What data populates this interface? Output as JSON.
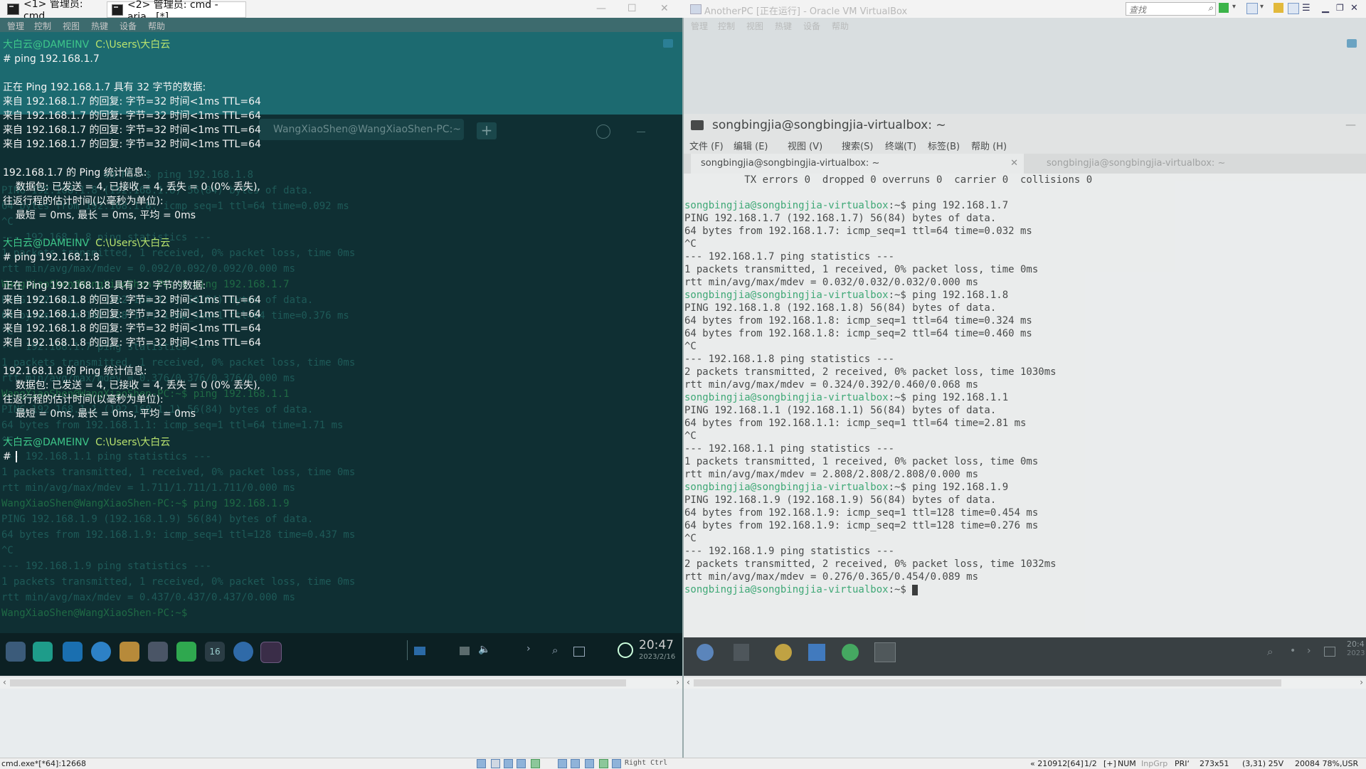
{
  "tabs": [
    {
      "label": "<1> 管理员: cmd"
    },
    {
      "label": "<2> 管理员: cmd - aria...[*]"
    }
  ],
  "vbox_title": "AnotherPC [正在运行] - Oracle VM VirtualBox",
  "search_placeholder": "查找",
  "vm_menu": [
    "管理",
    "控制",
    "视图",
    "热键",
    "设备",
    "帮助"
  ],
  "cmd": {
    "prompt_user": "大白云@DAMEINV",
    "prompt_path": "C:\\Users\\大白云",
    "lines_block1": [
      "# ping 192.168.1.7",
      "",
      "正在 Ping 192.168.1.7 具有 32 字节的数据:",
      "来自 192.168.1.7 的回复: 字节=32 时间<1ms TTL=64",
      "来自 192.168.1.7 的回复: 字节=32 时间<1ms TTL=64",
      "来自 192.168.1.7 的回复: 字节=32 时间<1ms TTL=64",
      "来自 192.168.1.7 的回复: 字节=32 时间<1ms TTL=64",
      "",
      "192.168.1.7 的 Ping 统计信息:",
      "    数据包: 已发送 = 4, 已接收 = 4, 丢失 = 0 (0% 丢失),",
      "往返行程的估计时间(以毫秒为单位):",
      "    最短 = 0ms, 最长 = 0ms, 平均 = 0ms"
    ],
    "lines_block2": [
      "# ping 192.168.1.8",
      "",
      "正在 Ping 192.168.1.8 具有 32 字节的数据:",
      "来自 192.168.1.8 的回复: 字节=32 时间<1ms TTL=64",
      "来自 192.168.1.8 的回复: 字节=32 时间<1ms TTL=64",
      "来自 192.168.1.8 的回复: 字节=32 时间<1ms TTL=64",
      "来自 192.168.1.8 的回复: 字节=32 时间<1ms TTL=64",
      "",
      "192.168.1.8 的 Ping 统计信息:",
      "    数据包: 已发送 = 4, 已接收 = 4, 丢失 = 0 (0% 丢失),",
      "往返行程的估计时间(以毫秒为单位):",
      "    最短 = 0ms, 最长 = 0ms, 平均 = 0ms"
    ],
    "last_prompt_hash": "#"
  },
  "deepin": {
    "tab_label": "WangXiaoShen@WangXiaoShen-PC:~",
    "bg_lines": [
      "                 en-PC:~$ ping 192.168.1.8",
      "PING 192.168.1.8 (192.168.1.8) 56(84) bytes of data.",
      "64 bytes from 192.168.1.8: icmp_seq=1 ttl=64 time=0.092 ms",
      "^C",
      "--- 192.168.1.8 ping statistics ---",
      "1 packets transmitted, 1 received, 0% packet loss, time 0ms",
      "rtt min/avg/max/mdev = 0.092/0.092/0.092/0.000 ms",
      "WangXiaoShen@WangXiaoShen-PC:~$ ping 192.168.1.7",
      "PING 192.168.1.7 (192.168.1.7) 56(84) bytes of data.",
      "64 bytes from 192.168.1.7: icmp_seq=1 ttl=64 time=0.376 ms",
      "^C",
      "--- 192.168.1.7 ping statistics ---",
      "1 packets transmitted, 1 received, 0% packet loss, time 0ms",
      "rtt min/avg/max/mdev = 0.376/0.376/0.376/0.000 ms",
      "WangXiaoShen@WangXiaoShen-PC:~$ ping 192.168.1.1",
      "PING 192.168.1.1 (192.168.1.1) 56(84) bytes of data.",
      "64 bytes from 192.168.1.1: icmp_seq=1 ttl=64 time=1.71 ms",
      "^C",
      "--- 192.168.1.1 ping statistics ---",
      "1 packets transmitted, 1 received, 0% packet loss, time 0ms",
      "rtt min/avg/max/mdev = 1.711/1.711/1.711/0.000 ms",
      "WangXiaoShen@WangXiaoShen-PC:~$ ping 192.168.1.9",
      "PING 192.168.1.9 (192.168.1.9) 56(84) bytes of data.",
      "64 bytes from 192.168.1.9: icmp_seq=1 ttl=128 time=0.437 ms",
      "^C",
      "--- 192.168.1.9 ping statistics ---",
      "1 packets transmitted, 1 received, 0% packet loss, time 0ms",
      "rtt min/avg/max/mdev = 0.437/0.437/0.437/0.000 ms",
      "WangXiaoShen@WangXiaoShen-PC:~$"
    ],
    "clock": "20:47",
    "date": "2023/2/16",
    "dock_badge": "16"
  },
  "ubuntu": {
    "window_title": "songbingjia@songbingjia-virtualbox: ~",
    "menu": [
      "文件 (F)",
      "编辑 (E)",
      "视图 (V)",
      "搜索(S)",
      "终端(T)",
      "标签(B)",
      "帮助 (H)"
    ],
    "tab_active": "songbingjia@songbingjia-virtualbox: ~",
    "tab_inactive": "songbingjia@songbingjia-virtualbox: ~",
    "prompt": "songbingjia@songbingjia-virtualbox",
    "lines": [
      {
        "t": "          TX errors 0  dropped 0 overruns 0  carrier 0  collisions 0"
      },
      {
        "t": ""
      },
      {
        "p": "songbingjia@songbingjia-virtualbox",
        "t": ":~$ ping 192.168.1.7"
      },
      {
        "t": "PING 192.168.1.7 (192.168.1.7) 56(84) bytes of data."
      },
      {
        "t": "64 bytes from 192.168.1.7: icmp_seq=1 ttl=64 time=0.032 ms"
      },
      {
        "t": "^C"
      },
      {
        "t": "--- 192.168.1.7 ping statistics ---"
      },
      {
        "t": "1 packets transmitted, 1 received, 0% packet loss, time 0ms"
      },
      {
        "t": "rtt min/avg/max/mdev = 0.032/0.032/0.032/0.000 ms"
      },
      {
        "p": "songbingjia@songbingjia-virtualbox",
        "t": ":~$ ping 192.168.1.8"
      },
      {
        "t": "PING 192.168.1.8 (192.168.1.8) 56(84) bytes of data."
      },
      {
        "t": "64 bytes from 192.168.1.8: icmp_seq=1 ttl=64 time=0.324 ms"
      },
      {
        "t": "64 bytes from 192.168.1.8: icmp_seq=2 ttl=64 time=0.460 ms"
      },
      {
        "t": "^C"
      },
      {
        "t": "--- 192.168.1.8 ping statistics ---"
      },
      {
        "t": "2 packets transmitted, 2 received, 0% packet loss, time 1030ms"
      },
      {
        "t": "rtt min/avg/max/mdev = 0.324/0.392/0.460/0.068 ms"
      },
      {
        "p": "songbingjia@songbingjia-virtualbox",
        "t": ":~$ ping 192.168.1.1"
      },
      {
        "t": "PING 192.168.1.1 (192.168.1.1) 56(84) bytes of data."
      },
      {
        "t": "64 bytes from 192.168.1.1: icmp_seq=1 ttl=64 time=2.81 ms"
      },
      {
        "t": "^C"
      },
      {
        "t": "--- 192.168.1.1 ping statistics ---"
      },
      {
        "t": "1 packets transmitted, 1 received, 0% packet loss, time 0ms"
      },
      {
        "t": "rtt min/avg/max/mdev = 2.808/2.808/2.808/0.000 ms"
      },
      {
        "p": "songbingjia@songbingjia-virtualbox",
        "t": ":~$ ping 192.168.1.9"
      },
      {
        "t": "PING 192.168.1.9 (192.168.1.9) 56(84) bytes of data."
      },
      {
        "t": "64 bytes from 192.168.1.9: icmp_seq=1 ttl=128 time=0.454 ms"
      },
      {
        "t": "64 bytes from 192.168.1.9: icmp_seq=2 ttl=128 time=0.276 ms"
      },
      {
        "t": "^C"
      },
      {
        "t": "--- 192.168.1.9 ping statistics ---"
      },
      {
        "t": "2 packets transmitted, 2 received, 0% packet loss, time 1032ms"
      },
      {
        "t": "rtt min/avg/max/mdev = 0.276/0.365/0.454/0.089 ms"
      },
      {
        "p": "songbingjia@songbingjia-virtualbox",
        "t": ":~$ "
      }
    ],
    "clock": "20:4",
    "date": "2023"
  },
  "statusbar": {
    "left": "cmd.exe*[*64]:12668",
    "right_ctrl": "Right Ctrl",
    "pos": "« 210912[64]",
    "page": "1/2",
    "plus": "[+]",
    "num": "NUM",
    "inpgrp": "InpGrp",
    "pri": "PRI‘",
    "size": "273x51",
    "coords": "(3,31) 25V",
    "mem": "20084 78%,USR"
  },
  "colors": {
    "cmd_bg_top": "#1c6a70",
    "deepin_bg": "#0f2f33",
    "prompt_green": "#3ec78a",
    "ubuntu_prompt": "#27a86a",
    "ubuntu_tab_accent": "#f07746"
  }
}
